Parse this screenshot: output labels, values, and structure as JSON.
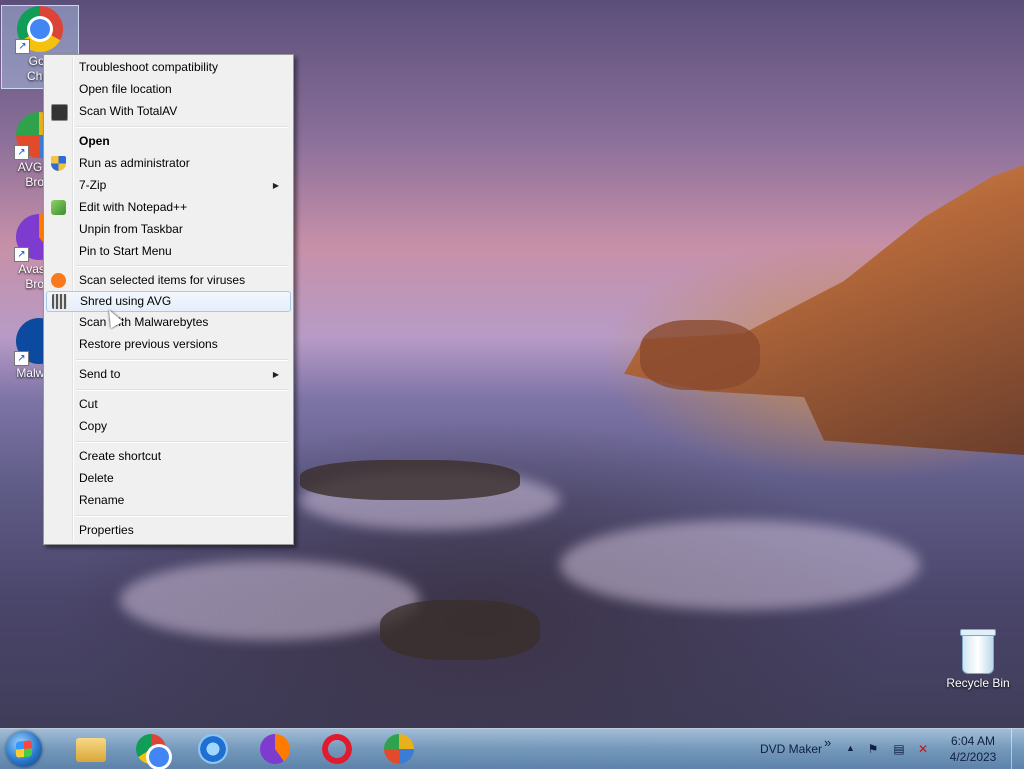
{
  "desktop": {
    "icons": [
      {
        "label": "Google Chrome",
        "line1": "Goo",
        "line2": "Chro",
        "icon": "chrome-icon"
      },
      {
        "label": "AVG Secure Browser",
        "line1": "AVG Se",
        "line2": "Brow",
        "icon": "avg-browser-icon"
      },
      {
        "label": "Avast Secure Browser",
        "line1": "Avast S",
        "line2": "Brow",
        "icon": "avast-browser-icon"
      },
      {
        "label": "Malwarebytes",
        "line1": "Malware",
        "line2": "",
        "icon": "malwarebytes-icon"
      }
    ],
    "recycle_bin": {
      "label": "Recycle Bin",
      "icon": "recycle-bin-icon"
    }
  },
  "context_menu": {
    "items": [
      {
        "label": "Troubleshoot compatibility"
      },
      {
        "label": "Open file location"
      },
      {
        "label": "Scan With TotalAV",
        "icon": "totalav-icon"
      },
      {
        "label": "Open",
        "bold": true
      },
      {
        "label": "Run as administrator",
        "icon": "shield-icon"
      },
      {
        "label": "7-Zip",
        "submenu": true
      },
      {
        "label": "Edit with Notepad++",
        "icon": "notepad-plus-plus-icon"
      },
      {
        "label": "Unpin from Taskbar"
      },
      {
        "label": "Pin to Start Menu"
      },
      {
        "label": "Scan selected items for viruses",
        "icon": "avast-icon"
      },
      {
        "label": "Shred using AVG",
        "icon": "shredder-icon",
        "highlighted": true
      },
      {
        "label": "Scan with Malwarebytes"
      },
      {
        "label": "Restore previous versions"
      },
      {
        "label": "Send to",
        "submenu": true
      },
      {
        "label": "Cut"
      },
      {
        "label": "Copy"
      },
      {
        "label": "Create shortcut"
      },
      {
        "label": "Delete"
      },
      {
        "label": "Rename"
      },
      {
        "label": "Properties"
      }
    ],
    "arrow_glyph": "▶"
  },
  "taskbar": {
    "start_icon": "windows-start-icon",
    "pinned": [
      {
        "name": "file-explorer",
        "icon": "folder-icon"
      },
      {
        "name": "google-chrome",
        "icon": "chrome-icon"
      },
      {
        "name": "internet-explorer",
        "icon": "internet-explorer-icon"
      },
      {
        "name": "avast-secure-browser",
        "icon": "avast-browser-icon"
      },
      {
        "name": "opera",
        "icon": "opera-icon"
      },
      {
        "name": "avg-secure-browser",
        "icon": "avg-browser-icon"
      }
    ],
    "toolbar_label": "DVD Maker",
    "toolbar_chevron": "»",
    "tray_expand": "▲",
    "tray_icons": [
      "flag-icon",
      "network-icon",
      "volume-muted-icon"
    ],
    "clock": {
      "time": "6:04 AM",
      "date": "4/2/2023"
    }
  },
  "colors": {
    "menu_bg": "#f0f0f0",
    "menu_border": "#979797",
    "highlight_border": "#a8c8ee",
    "taskbar": "#7ea6c8"
  }
}
